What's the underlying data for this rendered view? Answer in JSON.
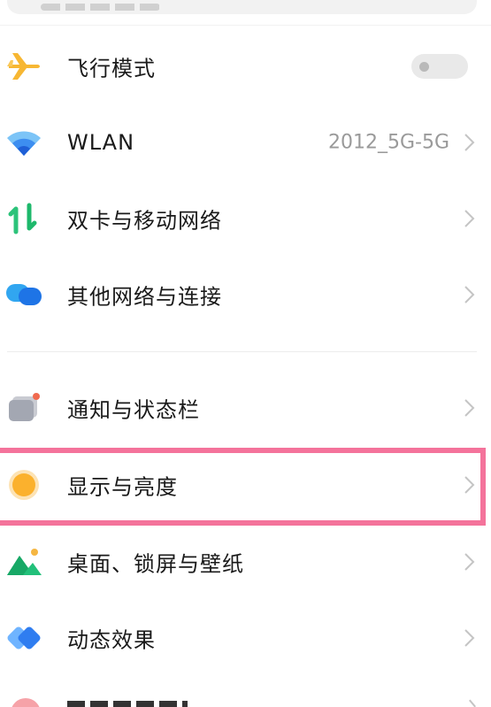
{
  "settings": {
    "items": [
      {
        "label": "飞行模式",
        "icon": "airplane-icon",
        "toggle_on": false
      },
      {
        "label": "WLAN",
        "value": "2012_5G-5G",
        "icon": "wifi-icon"
      },
      {
        "label": "双卡与移动网络",
        "icon": "sim-arrows-icon"
      },
      {
        "label": "其他网络与连接",
        "icon": "network-bubbles-icon"
      },
      {
        "label": "通知与状态栏",
        "icon": "notification-icon"
      },
      {
        "label": "显示与亮度",
        "icon": "brightness-icon",
        "highlighted": true
      },
      {
        "label": "桌面、锁屏与壁纸",
        "icon": "wallpaper-icon"
      },
      {
        "label": "动态效果",
        "icon": "animation-icon"
      }
    ]
  },
  "colors": {
    "highlight": "#f4739b",
    "value_text": "#9a9a9a",
    "chevron": "#c4c4c4"
  }
}
